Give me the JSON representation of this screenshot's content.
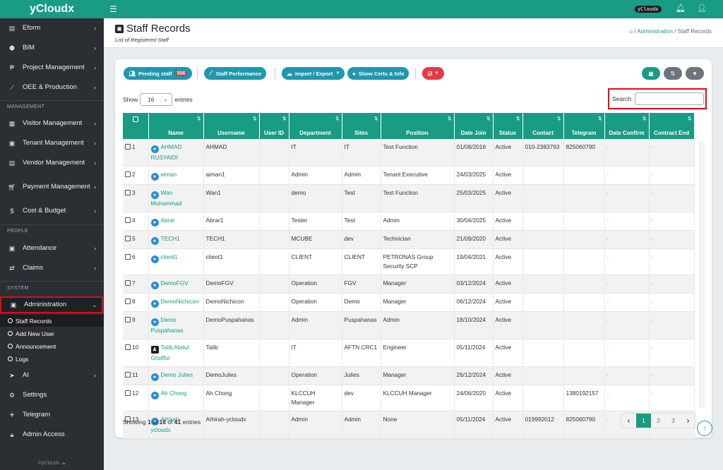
{
  "app": {
    "brand": "yCloudx",
    "badge": "yCloudx",
    "footer": "©yCloudx"
  },
  "sidebar": {
    "items": [
      {
        "label": "Eform",
        "icon": "file-icon"
      },
      {
        "label": "BIM",
        "icon": "cube-icon"
      },
      {
        "label": "Project Management",
        "icon": "project-icon"
      },
      {
        "label": "OEE & Production",
        "icon": "chart-icon"
      }
    ],
    "section_management": "MANAGEMENT",
    "mgmt_items": [
      {
        "label": "Visitor Management"
      },
      {
        "label": "Tenant Management"
      },
      {
        "label": "Vendor Management"
      },
      {
        "label": "Payment Management"
      },
      {
        "label": "Cost & Budget"
      }
    ],
    "section_people": "PEOPLE",
    "people_items": [
      {
        "label": "Attendance"
      },
      {
        "label": "Claims"
      }
    ],
    "section_system": "SYSTEM",
    "admin_label": "Administration",
    "admin_sub": [
      "Staff Records",
      "Add New User",
      "Announcement",
      "Logs"
    ],
    "system_items": [
      {
        "label": "AI"
      },
      {
        "label": "Settings"
      },
      {
        "label": "Telegram"
      },
      {
        "label": "Admin Access"
      }
    ]
  },
  "page": {
    "title": "Staff Records",
    "subtitle": "List of Registered Staff",
    "crumb_admin": "Administration",
    "crumb_current": "Staff Records",
    "crumb_sep": "/"
  },
  "toolbar": {
    "pending": "Pending staff",
    "pending_count": "506",
    "performance": "Staff Performance",
    "import_export": "Import / Export",
    "certs": "Show Certs & Info"
  },
  "table_controls": {
    "show": "Show",
    "entries_value": "16",
    "entries": "entries",
    "search_label": "Search:"
  },
  "columns": [
    "Name",
    "Username",
    "User ID",
    "Department",
    "Sites",
    "Position",
    "Date Join",
    "Status",
    "Contact",
    "Telegram",
    "Date Confirm",
    "Contract End"
  ],
  "rows": [
    {
      "n": "1",
      "name": "AHMAD RUSYAIDI",
      "username": "AHMAD",
      "uid": "",
      "dept": "IT",
      "site": "IT",
      "pos": "Test Function",
      "date": "01/08/2016",
      "status": "Active",
      "contact": "010-2383793",
      "tg": "825060790",
      "dc": "-",
      "ce": "-"
    },
    {
      "n": "2",
      "name": "aiman",
      "username": "aiman1",
      "uid": "",
      "dept": "Admin",
      "site": "Admin",
      "pos": "Tenant Executive",
      "date": "24/03/2025",
      "status": "Active",
      "contact": "",
      "tg": "",
      "dc": "-",
      "ce": "-"
    },
    {
      "n": "3",
      "name": "Wan Muhammad",
      "username": "Wan1",
      "uid": "",
      "dept": "demo",
      "site": "Test",
      "pos": "Test Function",
      "date": "25/03/2025",
      "status": "Active",
      "contact": "",
      "tg": "",
      "dc": "-",
      "ce": "-"
    },
    {
      "n": "4",
      "name": "Abrar",
      "username": "Abrar1",
      "uid": "",
      "dept": "Tester",
      "site": "Test",
      "pos": "Admin",
      "date": "30/04/2025",
      "status": "Active",
      "contact": "",
      "tg": "",
      "dc": "-",
      "ce": "-"
    },
    {
      "n": "5",
      "name": "TECH1",
      "username": "TECH1",
      "uid": "",
      "dept": "MCUBE",
      "site": "dev",
      "pos": "Technician",
      "date": "21/09/2020",
      "status": "Active",
      "contact": "",
      "tg": "",
      "dc": "-",
      "ce": "-"
    },
    {
      "n": "6",
      "name": "client1",
      "username": "client1",
      "uid": "",
      "dept": "CLIENT",
      "site": "CLIENT",
      "pos": "PETRONAS Group Security SCP",
      "date": "19/04/2021",
      "status": "Active",
      "contact": "",
      "tg": "",
      "dc": "-",
      "ce": "-"
    },
    {
      "n": "7",
      "name": "DemoFGV",
      "username": "DemoFGV",
      "uid": "",
      "dept": "Operation",
      "site": "FGV",
      "pos": "Manager",
      "date": "03/12/2024",
      "status": "Active",
      "contact": "",
      "tg": "",
      "dc": "-",
      "ce": "-"
    },
    {
      "n": "8",
      "name": "DemoNichicon",
      "username": "DemoNichicon",
      "uid": "",
      "dept": "Operation",
      "site": "Demo",
      "pos": "Manager",
      "date": "06/12/2024",
      "status": "Active",
      "contact": "",
      "tg": "",
      "dc": "-",
      "ce": "-"
    },
    {
      "n": "9",
      "name": "Demo Puspahanas",
      "username": "DemoPuspahanas",
      "uid": "",
      "dept": "Admin",
      "site": "Puspahanas",
      "pos": "Admin",
      "date": "18/10/2024",
      "status": "Active",
      "contact": "",
      "tg": "",
      "dc": "-",
      "ce": "-"
    },
    {
      "n": "10",
      "name": "Talib Abdul Ghaffur",
      "username": "Talib",
      "uid": "",
      "dept": "IT",
      "site": "AFTN CRC1",
      "pos": "Engineer",
      "date": "05/11/2024",
      "status": "Active",
      "contact": "",
      "tg": "",
      "dc": "-",
      "ce": "-"
    },
    {
      "n": "11",
      "name": "Demo Julies",
      "username": "DemoJulies",
      "uid": "",
      "dept": "Operation",
      "site": "Julies",
      "pos": "Manager",
      "date": "26/12/2024",
      "status": "Active",
      "contact": "",
      "tg": "",
      "dc": "-",
      "ce": "-"
    },
    {
      "n": "12",
      "name": "Ah Chong",
      "username": "Ah Chong",
      "uid": "",
      "dept": "KLCCUH Manager",
      "site": "dev",
      "pos": "KLCCUH Manager",
      "date": "24/06/2020",
      "status": "Active",
      "contact": "",
      "tg": "1380192157",
      "dc": "-",
      "ce": "-"
    },
    {
      "n": "13",
      "name": "Athirah-ycloudx",
      "username": "Athirah-ycloudx",
      "uid": "",
      "dept": "Admin",
      "site": "Admin",
      "pos": "None",
      "date": "05/11/2024",
      "status": "Active",
      "contact": "019992012",
      "tg": "825060790",
      "dc": "-",
      "ce": "-"
    }
  ],
  "info": {
    "a": "Showing ",
    "from": "1",
    "b": " to ",
    "to": "16",
    "c": " of ",
    "total": "41",
    "d": " entries"
  },
  "pagination": {
    "prev": "‹",
    "pages": [
      "1",
      "2",
      "3"
    ],
    "next": "›"
  }
}
